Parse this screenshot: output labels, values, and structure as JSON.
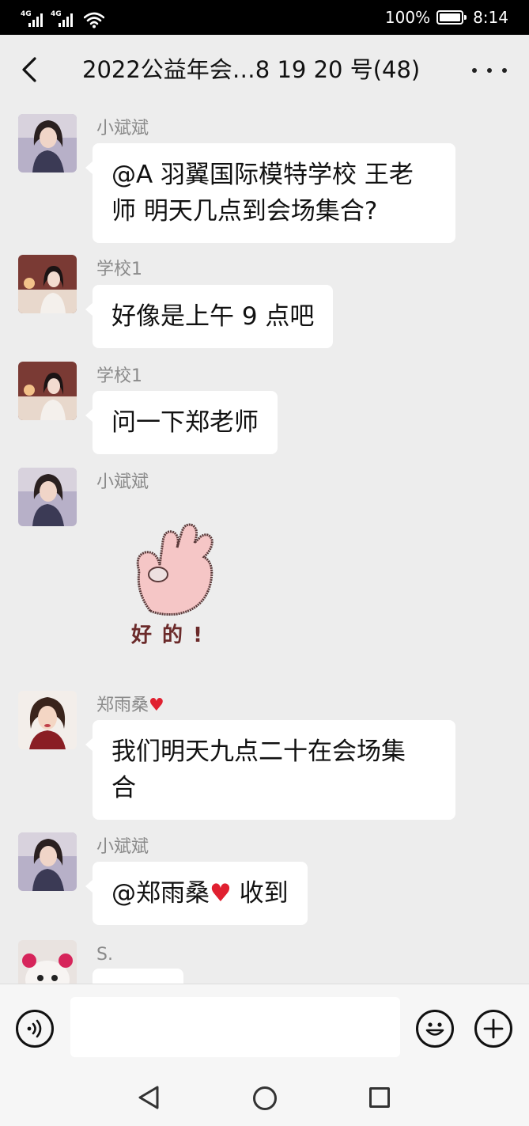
{
  "status_bar": {
    "signal1_label": "4G",
    "signal2_label": "4G",
    "battery_text": "100%",
    "battery_level": 1.0,
    "time": "8:14"
  },
  "header": {
    "title": "2022公益年会…8 19 20 号(48)",
    "back_icon": "chevron-left-icon",
    "more_icon": "more-dots-icon"
  },
  "messages": [
    {
      "sender": "小斌斌",
      "text_line1": "@A 羽翼国际模特学校 王老",
      "text_line2": "师  明天几点到会场集合?"
    },
    {
      "sender": "学校1",
      "text": "好像是上午 9 点吧"
    },
    {
      "sender": "学校1",
      "text": "问一下郑老师"
    },
    {
      "sender": "小斌斌",
      "sticker_text": "好 的 !",
      "sticker_icon": "ok-hand-sticker"
    },
    {
      "sender": "郑雨桑",
      "sender_heart": "♥",
      "text_line1": "我们明天九点二十在会场集",
      "text_line2": "合"
    },
    {
      "sender": "小斌斌",
      "text_part1": "@郑雨桑",
      "heart": "♥",
      "text_part2": " 收到"
    },
    {
      "sender": "S."
    }
  ],
  "input_bar": {
    "placeholder": "",
    "voice_icon": "voice-icon",
    "emoji_icon": "emoji-icon",
    "plus_icon": "plus-icon"
  },
  "nav": {
    "back_icon": "nav-back-icon",
    "home_icon": "nav-home-icon",
    "recent_icon": "nav-recent-icon"
  },
  "colors": {
    "background": "#ededed",
    "bubble": "#ffffff",
    "name_gray": "#8a8a8a",
    "heart": "#e02030"
  }
}
